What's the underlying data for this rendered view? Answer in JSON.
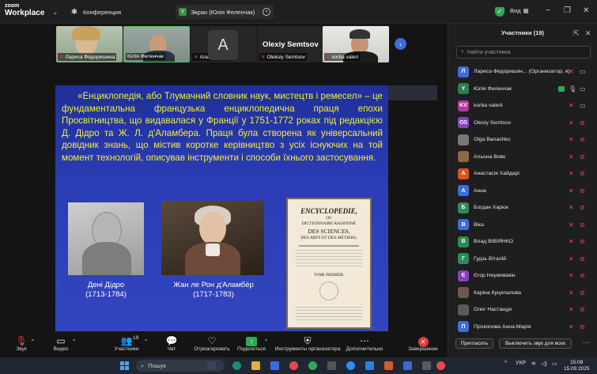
{
  "app": {
    "logo_line1": "zoom",
    "logo_line2": "Workplace"
  },
  "tabs": {
    "conference": "Конференция",
    "share_badge": "Y",
    "share_label": "Экран (Юлія Феленчак)"
  },
  "window": {
    "view_label": "Вид"
  },
  "thumbnails": [
    {
      "name": "Лариса Федоришина"
    },
    {
      "name": "Юлія Феленчак"
    },
    {
      "name": "Альона Вовк"
    },
    {
      "name": "Oleksiy Semtsov"
    },
    {
      "name": "korba valeri"
    }
  ],
  "avatar_letter": "A",
  "speaker_big_name": "Olexiy Semtsov",
  "slide": {
    "text": "«Енциклопедія, або Тлумачний словник наук, мистецтв і ремесел» – це фундаментальна французька енциклопедична праця епохи Просвітництва, що видавалася у Франції у 1751-1772 роках під редакцією Д. Дідро та Ж. Л. д'Аламбера. Праця була створена як універсальний довідник знань, що містив коротке керівництво з усіх існуючих на той момент технологій, описував інструменти і способи їхнього застосування.",
    "caption1_name": "Дені Дідро",
    "caption1_years": "(1713-1784)",
    "caption2_name": "Жан ле Рон д'Аламбéр",
    "caption2_years": "(1717-1783)",
    "book": {
      "title": "ENCYCLOPEDIE,",
      "line2": "OU",
      "line3": "DICTIONNAIRE RAISONNÉ",
      "line4": "DES SCIENCES,",
      "line5": "DES ARTS ET DES MÉTIERS,",
      "line6": "TOME PREMIER."
    }
  },
  "toolbar": {
    "audio": "Звук",
    "video": "Видео",
    "participants": "Участники",
    "participants_count": "19",
    "chat": "Чат",
    "react": "Отреагировать",
    "share": "Поделиться",
    "host_tools": "Инструменты организатора",
    "more": "Дополнительно",
    "end": "Завершение"
  },
  "panel": {
    "title": "Участники (19)",
    "search_placeholder": "Найти участника",
    "invite": "Пригласить",
    "mute_all": "Выключить звук для всех"
  },
  "participants": [
    {
      "avatar": "Л",
      "color": "#3b6de0",
      "name": "Лариса Федоришин... (Организатор, я)",
      "mic": "muted",
      "cam": "on"
    },
    {
      "avatar": "Y",
      "color": "#2e7d4f",
      "name": "Юлія Феленчак",
      "mic": "on",
      "cam": "on",
      "sharing": true
    },
    {
      "avatar": "KV",
      "color": "#b0399e",
      "name": "korba valerii",
      "mic": "muted",
      "cam": "on"
    },
    {
      "avatar": "OS",
      "color": "#8a3fbf",
      "name": "Olexiy Semtsov",
      "mic": "muted",
      "cam": "off"
    },
    {
      "avatar": "",
      "color": "#777777",
      "name": "Olga Banashko",
      "mic": "muted",
      "cam": "off"
    },
    {
      "avatar": "",
      "color": "#8a6a4a",
      "name": "Альона Вовк",
      "mic": "muted",
      "cam": "off"
    },
    {
      "avatar": "А",
      "color": "#d9561e",
      "name": "Анастасія Хайдарі",
      "mic": "muted",
      "cam": "off"
    },
    {
      "avatar": "А",
      "color": "#3b6de0",
      "name": "Анна",
      "mic": "muted",
      "cam": "off"
    },
    {
      "avatar": "Б",
      "color": "#2e8b57",
      "name": "Богдан Харюк",
      "mic": "muted",
      "cam": "off"
    },
    {
      "avatar": "В",
      "color": "#3b6de0",
      "name": "Віка",
      "mic": "muted",
      "cam": "off"
    },
    {
      "avatar": "В",
      "color": "#2e8b57",
      "name": "Влад ВІВЇЯНКО",
      "mic": "muted",
      "cam": "off"
    },
    {
      "avatar": "Г",
      "color": "#2e8b57",
      "name": "Гудзь Віталій",
      "mic": "muted",
      "cam": "off"
    },
    {
      "avatar": "Є",
      "color": "#8a3fbf",
      "name": "Єгор Неумивакін",
      "mic": "muted",
      "cam": "off"
    },
    {
      "avatar": "",
      "color": "#6a5a50",
      "name": "Каріна Куцепалова",
      "mic": "muted",
      "cam": "off"
    },
    {
      "avatar": "",
      "color": "#5a5a5a",
      "name": "Олег Настащук",
      "mic": "muted",
      "cam": "off"
    },
    {
      "avatar": "П",
      "color": "#3b6de0",
      "name": "Прокопова Анна-Марія",
      "mic": "muted",
      "cam": "off"
    }
  ],
  "taskbar": {
    "search": "Пошук",
    "lang": "УКР",
    "time": "15:08",
    "date": "15.09.2025"
  }
}
